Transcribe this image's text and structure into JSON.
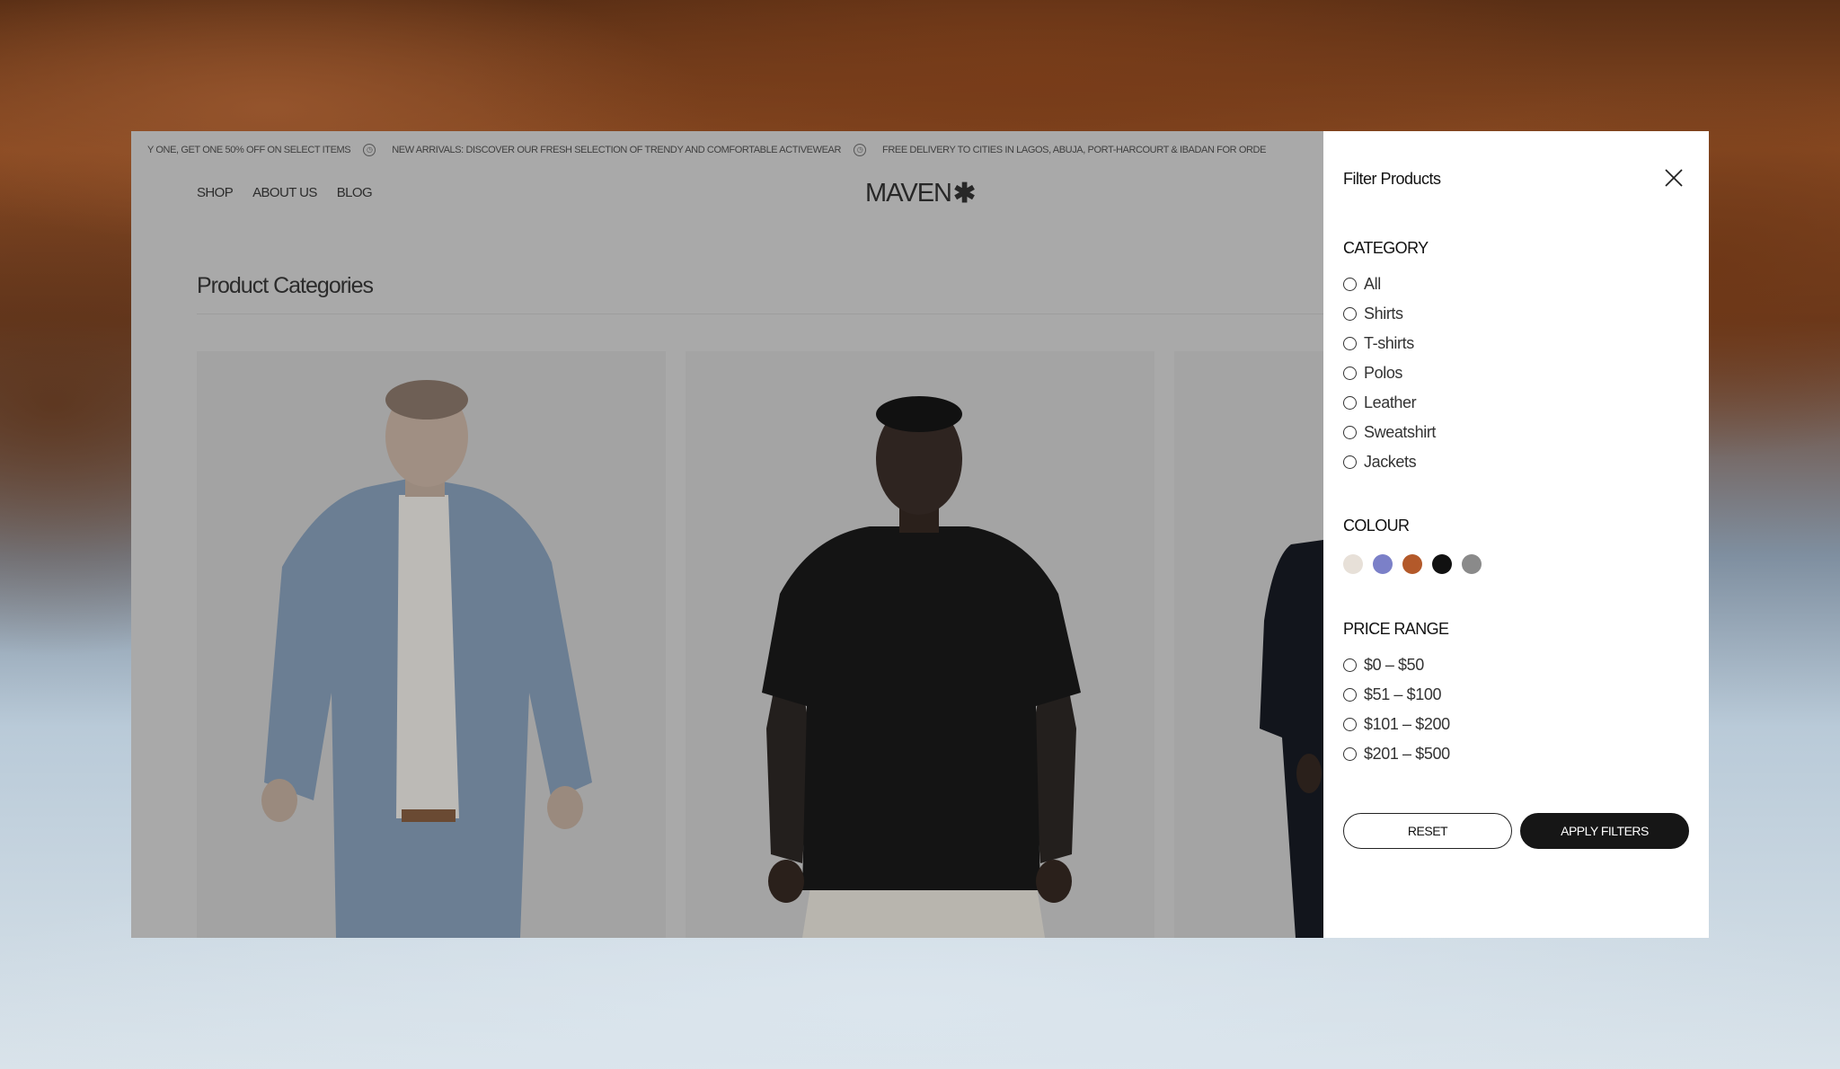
{
  "ticker": {
    "items": [
      "Y ONE, GET ONE 50% OFF ON SELECT ITEMS",
      "NEW ARRIVALS: DISCOVER OUR FRESH SELECTION OF TRENDY AND COMFORTABLE ACTIVEWEAR",
      "FREE DELIVERY TO CITIES IN LAGOS, ABUJA, PORT-HARCOURT & IBADAN FOR ORDE"
    ]
  },
  "nav": {
    "shop": "SHOP",
    "about": "ABOUT US",
    "blog": "BLOG"
  },
  "brand": {
    "name": "MAVEN",
    "mark": "✱"
  },
  "page": {
    "title": "Product Categories"
  },
  "filter": {
    "title": "Filter Products",
    "category": {
      "title": "CATEGORY",
      "options": [
        "All",
        "Shirts",
        "T-shirts",
        "Polos",
        "Leather",
        "Sweatshirt",
        "Jackets"
      ]
    },
    "colour": {
      "title": "COLOUR",
      "swatches": [
        "#e7e0d8",
        "#7b80c8",
        "#b3592a",
        "#111111",
        "#8a8a8a"
      ]
    },
    "price": {
      "title": "PRICE RANGE",
      "options": [
        "$0 – $50",
        "$51 – $100",
        "$101 – $200",
        "$201 – $500"
      ]
    },
    "reset_label": "RESET",
    "apply_label": "APPLY FILTERS"
  },
  "icons": {
    "close": "close-icon",
    "ticker_separator": "circle-icon"
  }
}
